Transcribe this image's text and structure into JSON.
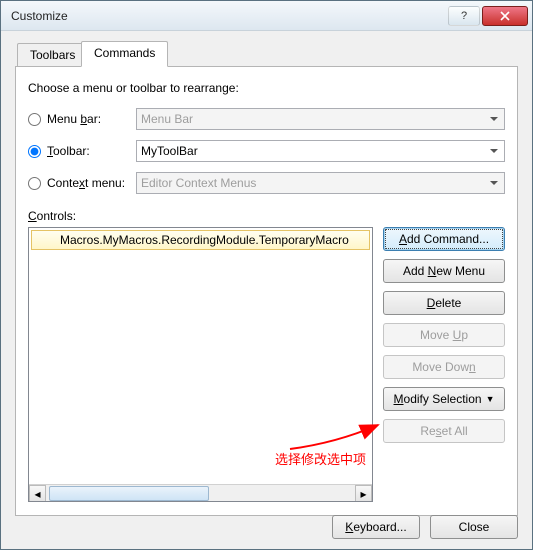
{
  "window": {
    "title": "Customize"
  },
  "tabs": {
    "toolbars": "Toolbars",
    "commands": "Commands"
  },
  "prompt": "Choose a menu or toolbar to rearrange:",
  "radios": {
    "menubar": {
      "pre": "Menu ",
      "ul": "b",
      "post": "ar:"
    },
    "toolbar": {
      "pre": "",
      "ul": "T",
      "post": "oolbar:"
    },
    "context": {
      "pre": "Conte",
      "ul": "x",
      "post": "t menu:"
    }
  },
  "combos": {
    "menubar": "Menu Bar",
    "toolbar": "MyToolBar",
    "context": "Editor Context Menus"
  },
  "controls_label": {
    "ul": "C",
    "post": "ontrols:"
  },
  "list": {
    "item": "Macros.MyMacros.RecordingModule.TemporaryMacro"
  },
  "buttons": {
    "add_command": {
      "pre": "",
      "ul": "A",
      "post": "dd Command..."
    },
    "add_menu": {
      "pre": "Add ",
      "ul": "N",
      "post": "ew Menu"
    },
    "delete": {
      "pre": "",
      "ul": "D",
      "post": "elete"
    },
    "move_up": {
      "pre": "Move ",
      "ul": "U",
      "post": "p"
    },
    "move_down": {
      "pre": "Move Dow",
      "ul": "n",
      "post": ""
    },
    "modify": {
      "pre": "",
      "ul": "M",
      "post": "odify Selection"
    },
    "reset": {
      "pre": "Re",
      "ul": "s",
      "post": "et All"
    },
    "keyboard": {
      "pre": "",
      "ul": "K",
      "post": "eyboard..."
    },
    "close": "Close"
  },
  "annotation": "选择修改选中项"
}
